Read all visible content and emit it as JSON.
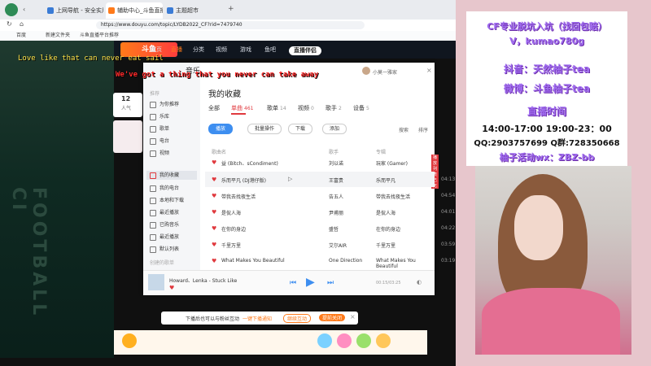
{
  "browser": {
    "tabs": [
      {
        "label": "上网导航 - 安全实用..."
      },
      {
        "label": "斗鱼直播-个..."
      },
      {
        "label": "辅助中心_斗鱼直播平..."
      },
      {
        "label": "主题超市"
      }
    ],
    "url": "https://www.douyu.com/topic/LYDB2022_CF?rid=7479740",
    "bookmarks": [
      "百度",
      "新建文件夹",
      "斗鱼直播平台推荐"
    ]
  },
  "site": {
    "logo": "斗鱼",
    "nav": [
      "首页",
      "直播",
      "分类",
      "视频",
      "游戏",
      "鱼吧"
    ],
    "nav_badge": "直播伴侣",
    "rank_num": "12",
    "rank_label": "人气",
    "rank_sub": "影响力 第2"
  },
  "overlay": {
    "lyric_line1": "Love like that can never eat sail",
    "lyric_line2": "We've got a thing that you never can take away"
  },
  "music": {
    "app_title": "音乐",
    "heading": "我的收藏",
    "user": "小莫一雅家",
    "tabs": [
      {
        "label": "全部",
        "count": ""
      },
      {
        "label": "单曲",
        "count": "461"
      },
      {
        "label": "歌单",
        "count": "14"
      },
      {
        "label": "视频",
        "count": "0"
      },
      {
        "label": "歌手",
        "count": "2"
      },
      {
        "label": "设备",
        "count": "5"
      }
    ],
    "actions": [
      "播放",
      "批量操作",
      "下载",
      "添加"
    ],
    "search_label": "搜索",
    "sort_label": "排序",
    "columns": [
      "歌曲名",
      "歌手",
      "专辑"
    ],
    "sidebar": [
      {
        "label": "推荐"
      },
      {
        "label": "为你推荐"
      },
      {
        "label": "乐库"
      },
      {
        "label": "歌单"
      },
      {
        "label": "电台"
      },
      {
        "label": "视频"
      },
      {
        "label": "我的收藏"
      },
      {
        "label": "我的电台"
      },
      {
        "label": "本地和下载"
      },
      {
        "label": "最近播放"
      },
      {
        "label": "已购音乐"
      },
      {
        "label": "最近播放"
      },
      {
        "label": "默认列表"
      },
      {
        "label": "创建的歌单"
      }
    ],
    "songs": [
      {
        "title": "益 (Bitch、sCondiment)",
        "artist": "刘以诺",
        "album": "玩家 (Gamer)",
        "duration": "03:33",
        "tag": "播放列表已无"
      },
      {
        "title": "乐而平凡 (DJ港仔版)",
        "artist": "王富贵",
        "album": "乐而平凡",
        "duration": "04:13"
      },
      {
        "title": "带我去找夜生活",
        "artist": "告五人",
        "album": "带我去找夜生活",
        "duration": "04:54"
      },
      {
        "title": "是侃人海",
        "artist": "尹甫丽",
        "album": "是侃人海",
        "duration": "04:01"
      },
      {
        "title": "在你的身边",
        "artist": "盛哲",
        "album": "在你的身边",
        "duration": "04:22"
      },
      {
        "title": "千里万里",
        "artist": "艾尔AIR",
        "album": "千里万里",
        "duration": "03:59"
      },
      {
        "title": "What Makes You Beautiful",
        "artist": "One Direction",
        "album": "What Makes You Beautiful",
        "duration": "03:19"
      }
    ],
    "now_playing": "Howard、Lenka - Stuck Like",
    "time": "00:15/03:25"
  },
  "notice": {
    "text": "下播后也可以与粉丝互动",
    "link": "一键下播通知",
    "btn1": "继续互动",
    "btn2": "提前关闭"
  },
  "promo": {
    "line1": "CF专业脱坑入坑（找回包赔）",
    "line2": "V，kumao780g",
    "line3": "抖音：天然柚子tea",
    "line4": "微博：斗鱼柚子tea",
    "line5": "直播时间",
    "line6": "14:00-17:00  19:00-23：00",
    "line7": "QQ:2903757699 Q群:728350668",
    "line8": "柚子活动wx：ZBZ-bb"
  },
  "colors": {
    "accent": "#e0393e",
    "promo_purple": "#a06cf0",
    "frame_pink": "#e7c6cc"
  }
}
